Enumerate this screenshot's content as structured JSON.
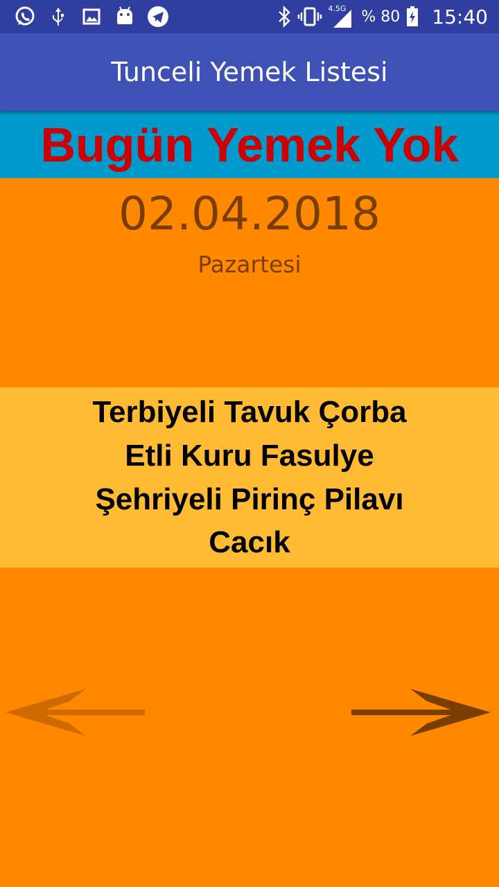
{
  "status_bar": {
    "left_icons": [
      "whatsapp-icon",
      "usb-icon",
      "image-icon",
      "android-icon",
      "telegram-icon"
    ],
    "network_label": "4.5G",
    "battery_text": "% 80",
    "clock": "15:40"
  },
  "app_bar": {
    "title": "Tunceli Yemek Listesi"
  },
  "banner": {
    "text": "Bugün Yemek Yok"
  },
  "day": {
    "date": "02.04.2018",
    "weekday": "Pazartesi"
  },
  "menu": {
    "items": [
      "Terbiyeli Tavuk Çorba",
      "Etli Kuru Fasulye",
      "Şehriyeli Pirinç Pilavı",
      "Cacık"
    ]
  },
  "navigation": {
    "prev_icon": "arrow-left-icon",
    "next_icon": "arrow-right-icon"
  },
  "colors": {
    "status_bar": "#303f9f",
    "app_bar": "#3f51b5",
    "banner_bg": "#0099cc",
    "banner_text": "#cc0000",
    "page_bg": "#ff8800",
    "menu_bg": "#ffbb33",
    "date_text": "#7a3d00"
  }
}
